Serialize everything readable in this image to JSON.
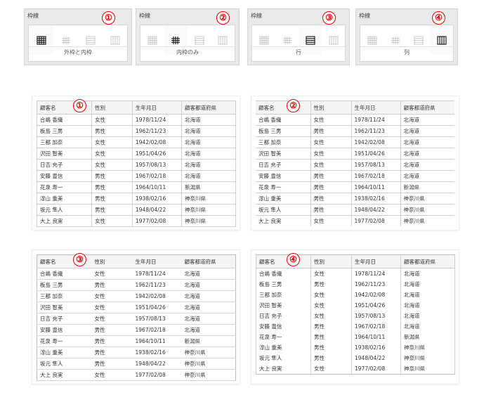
{
  "marker_color": "#e00000",
  "panels": [
    {
      "title": "枠線",
      "caption": "外枠と内枠",
      "marker": "①",
      "selected": 0
    },
    {
      "title": "枠線",
      "caption": "内枠のみ",
      "marker": "②",
      "selected": 1
    },
    {
      "title": "枠線",
      "caption": "行",
      "marker": "③",
      "selected": 2
    },
    {
      "title": "枠線",
      "caption": "列",
      "marker": "④",
      "selected": 3
    }
  ],
  "options": [
    {
      "name": "all-borders-icon"
    },
    {
      "name": "inner-borders-icon"
    },
    {
      "name": "row-borders-icon"
    },
    {
      "name": "column-borders-icon"
    }
  ],
  "table": {
    "headers": [
      "顧客名",
      "性別",
      "生年月日",
      "顧客都道府県"
    ],
    "rows": [
      [
        "合嶋 香織",
        "女性",
        "1978/11/24",
        "北海道"
      ],
      [
        "板島 三男",
        "男性",
        "1962/11/23",
        "北海道"
      ],
      [
        "三都 加奈",
        "女性",
        "1942/02/08",
        "北海道"
      ],
      [
        "沢田 智美",
        "女性",
        "1951/04/26",
        "北海道"
      ],
      [
        "日吉 充子",
        "女性",
        "1957/08/13",
        "北海道"
      ],
      [
        "安藤 豊信",
        "男性",
        "1967/02/18",
        "北海道"
      ],
      [
        "花泉 寿一",
        "男性",
        "1964/10/11",
        "新潟県"
      ],
      [
        "淳山 重美",
        "男性",
        "1938/02/16",
        "神奈川県"
      ],
      [
        "坂元 隼人",
        "男性",
        "1948/04/22",
        "神奈川県"
      ],
      [
        "大上 良実",
        "女性",
        "1977/02/08",
        "神奈川県"
      ]
    ]
  },
  "examples": [
    {
      "marker": "①",
      "variant": "outer-and-inner"
    },
    {
      "marker": "②",
      "variant": "inner-only"
    },
    {
      "marker": "③",
      "variant": "rows"
    },
    {
      "marker": "④",
      "variant": "columns"
    }
  ]
}
